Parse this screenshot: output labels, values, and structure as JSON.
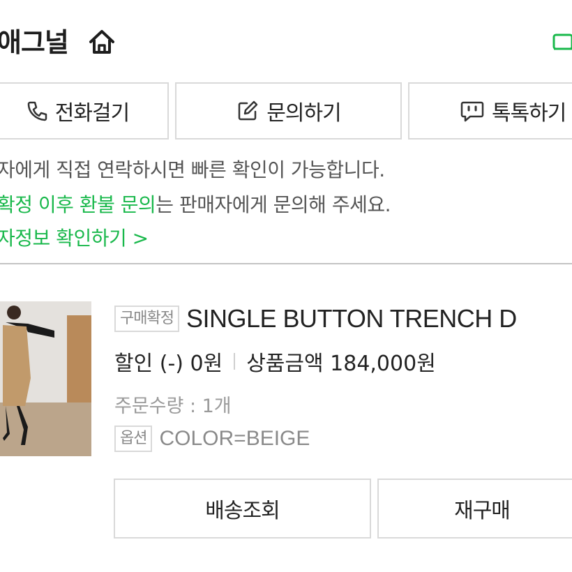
{
  "header": {
    "store_name": "애그널"
  },
  "contact_buttons": [
    {
      "label": "전화걸기",
      "icon": "phone-icon"
    },
    {
      "label": "문의하기",
      "icon": "edit-icon"
    },
    {
      "label": "톡톡하기",
      "icon": "chat-icon"
    }
  ],
  "notices": {
    "line1": "자에게 직접 연락하시면 빠른 확인이 가능합니다.",
    "line2_highlight": "확정 이후 환불 문의",
    "line2_rest": "는 판매자에게 문의해 주세요.",
    "line3": "자정보 확인하기 >"
  },
  "product": {
    "status_tag": "구매확정",
    "name": "SINGLE BUTTON TRENCH D",
    "discount": "할인 (-) 0원",
    "amount": "상품금액 184,000원",
    "quantity": "주문수량 : 1개",
    "option_tag": "옵션",
    "option_value": "COLOR=BEIGE"
  },
  "actions": {
    "track_label": "배송조회",
    "reorder_label": "재구매"
  },
  "colors": {
    "accent_green": "#19b84b",
    "border": "#d9d9d9"
  }
}
